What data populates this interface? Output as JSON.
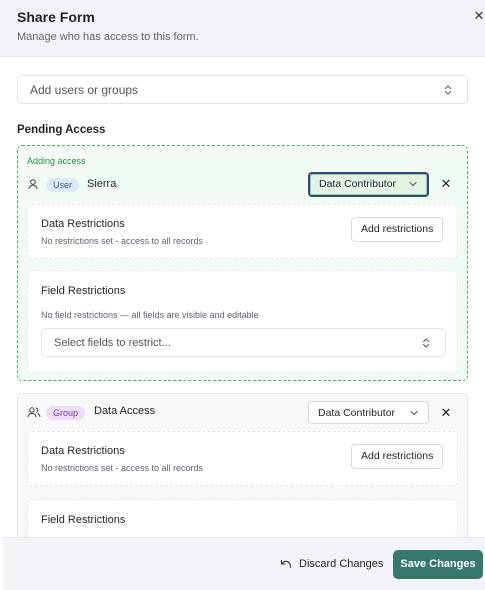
{
  "header": {
    "title": "Share Form",
    "subtitle": "Manage who has access to this form.",
    "close_icon": "close-icon"
  },
  "add_users": {
    "placeholder": "Add users or groups",
    "icon": "chevron-up-down-icon"
  },
  "pending_section": {
    "label": "Pending Access"
  },
  "pending_entry": {
    "status_label": "Adding access",
    "type_icon": "user-icon",
    "badge": "User",
    "name": "Sierra",
    "role": "Data Contributor",
    "data_restrictions": {
      "title": "Data Restrictions",
      "description": "No restrictions set - access to all records",
      "button": "Add restrictions"
    },
    "field_restrictions": {
      "title": "Field Restrictions",
      "description": "No field restrictions — all fields are visible and editable",
      "select_placeholder": "Select fields to restrict..."
    }
  },
  "group_entry": {
    "type_icon": "users-icon",
    "badge": "Group",
    "name": "Data Access",
    "role": "Data Contributor",
    "data_restrictions": {
      "title": "Data Restrictions",
      "description": "No restrictions set - access to all records",
      "button": "Add restrictions"
    },
    "field_restrictions": {
      "title": "Field Restrictions"
    }
  },
  "footer": {
    "discard_label": "Discard Changes",
    "discard_icon": "undo-icon",
    "save_label": "Save Changes"
  },
  "colors": {
    "accent": "#37786a",
    "pending_border": "#4caf6b",
    "pending_bg": "#f1fbf3",
    "user_badge_bg": "#dce8f7",
    "group_badge_bg": "#ecdcf6"
  }
}
